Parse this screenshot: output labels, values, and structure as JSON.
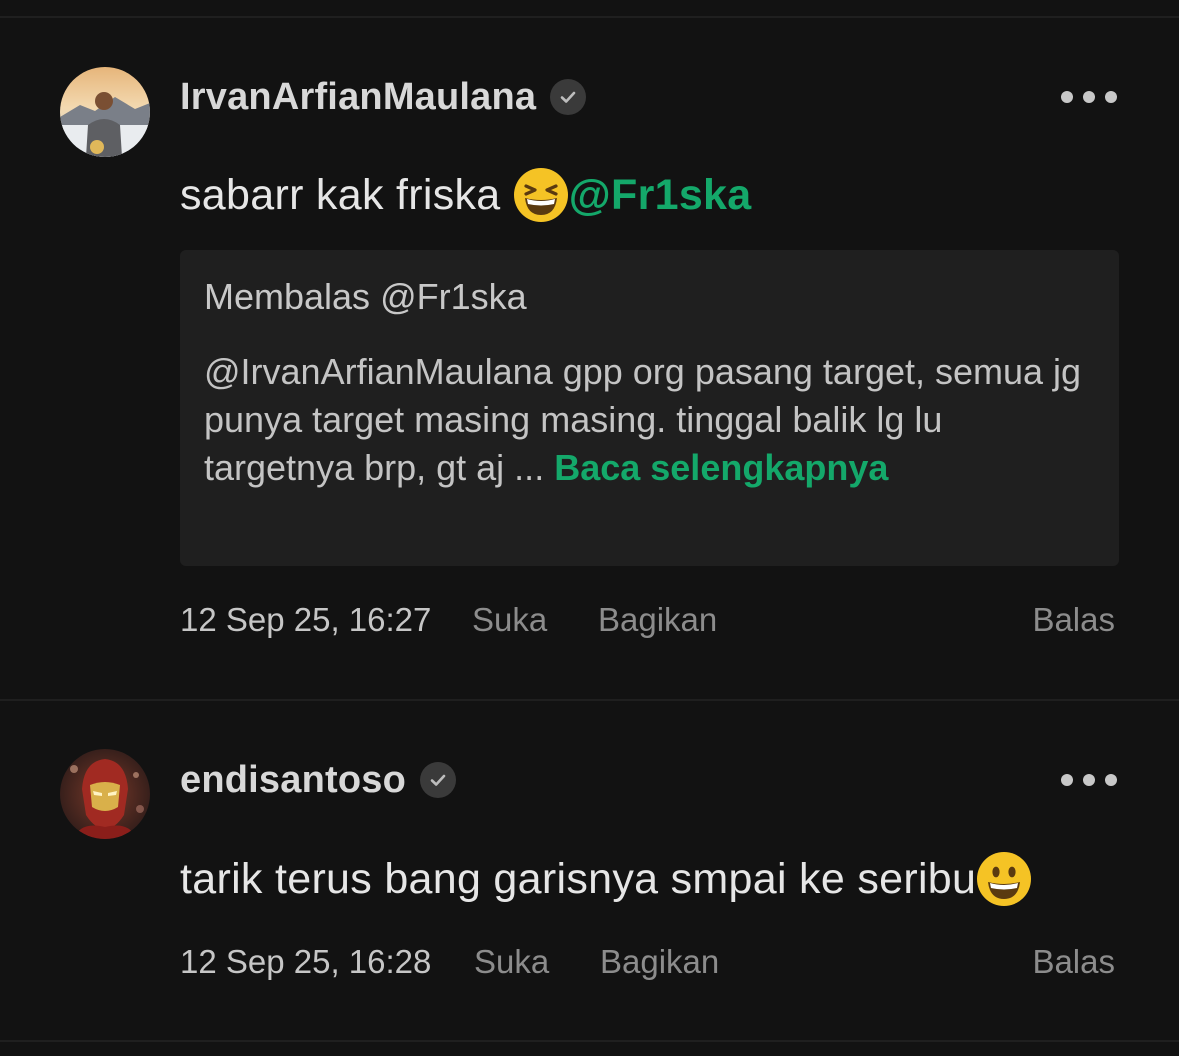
{
  "comments": [
    {
      "username": "IrvanArfianMaulana",
      "verified": true,
      "text_before": "sabarr kak friska ",
      "emoji": "grinning-squinting-face",
      "mention": "@Fr1ska",
      "reply_context": {
        "header": "Membalas @Fr1ska",
        "body": "@IrvanArfianMaulana gpp org pasang target, semua jg punya target masing masing. tinggal balik lg lu targetnya brp, gt aj ... ",
        "read_more": "Baca selengkapnya"
      },
      "timestamp": "12 Sep 25, 16:27",
      "like_label": "Suka",
      "share_label": "Bagikan",
      "reply_label": "Balas"
    },
    {
      "username": "endisantoso",
      "verified": true,
      "text_before": "tarik terus bang garisnya smpai ke seribu",
      "emoji": "grinning-face",
      "timestamp": "12 Sep 25, 16:28",
      "like_label": "Suka",
      "share_label": "Bagikan",
      "reply_label": "Balas"
    }
  ],
  "colors": {
    "background": "#121212",
    "mention": "#14a86a",
    "reply_box": "#1f1f1f",
    "muted": "#8c8c8c"
  }
}
